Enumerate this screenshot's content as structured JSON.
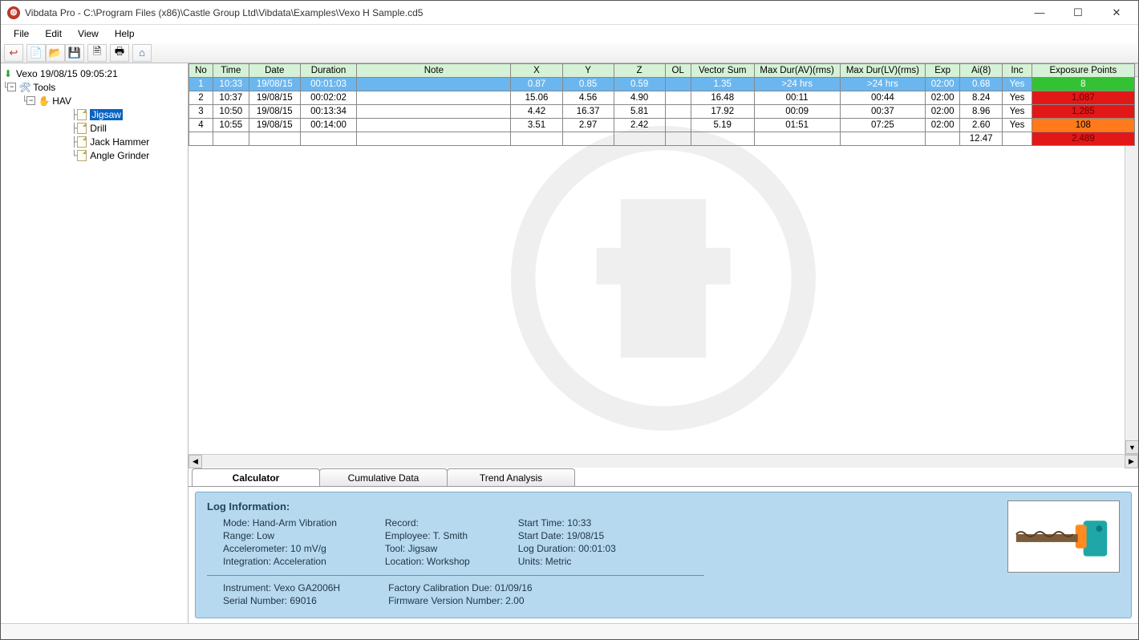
{
  "window": {
    "title": "Vibdata Pro - C:\\Program Files (x86)\\Castle Group Ltd\\Vibdata\\Examples\\Vexo H Sample.cd5"
  },
  "menu": {
    "file": "File",
    "edit": "Edit",
    "view": "View",
    "help": "Help"
  },
  "toolbar_icons": {
    "undo": "↩",
    "new": "📄",
    "open": "📂",
    "save": "💾",
    "doc": "🗎",
    "print": "🖶",
    "home": "⌂"
  },
  "tree": {
    "root": "Vexo 19/08/15 09:05:21",
    "tools": "Tools",
    "hav": "HAV",
    "items": [
      "Jigsaw",
      "Drill",
      "Jack Hammer",
      "Angle Grinder"
    ],
    "selected": "Jigsaw"
  },
  "columns": [
    "No",
    "Time",
    "Date",
    "Duration",
    "Note",
    "X",
    "Y",
    "Z",
    "OL",
    "Vector Sum",
    "Max Dur(AV)(rms)",
    "Max Dur(LV)(rms)",
    "Exp",
    "Ai(8)",
    "Inc",
    "Exposure Points"
  ],
  "rows": [
    {
      "no": "1",
      "time": "10:33",
      "date": "19/08/15",
      "duration": "00:01:03",
      "note": "",
      "x": "0.87",
      "y": "0.85",
      "z": "0.59",
      "ol": "",
      "vsum": "1.35",
      "maxav": ">24 hrs",
      "maxlv": ">24 hrs",
      "exp": "02:00",
      "ai8": "0.68",
      "inc": "Yes",
      "ep": "8",
      "ep_class": "ep-green",
      "selected": true
    },
    {
      "no": "2",
      "time": "10:37",
      "date": "19/08/15",
      "duration": "00:02:02",
      "note": "",
      "x": "15.06",
      "y": "4.56",
      "z": "4.90",
      "ol": "",
      "vsum": "16.48",
      "maxav": "00:11",
      "maxlv": "00:44",
      "exp": "02:00",
      "ai8": "8.24",
      "inc": "Yes",
      "ep": "1,087",
      "ep_class": "ep-red"
    },
    {
      "no": "3",
      "time": "10:50",
      "date": "19/08/15",
      "duration": "00:13:34",
      "note": "",
      "x": "4.42",
      "y": "16.37",
      "z": "5.81",
      "ol": "",
      "vsum": "17.92",
      "maxav": "00:09",
      "maxlv": "00:37",
      "exp": "02:00",
      "ai8": "8.96",
      "inc": "Yes",
      "ep": "1,285",
      "ep_class": "ep-red"
    },
    {
      "no": "4",
      "time": "10:55",
      "date": "19/08/15",
      "duration": "00:14:00",
      "note": "",
      "x": "3.51",
      "y": "2.97",
      "z": "2.42",
      "ol": "",
      "vsum": "5.19",
      "maxav": "01:51",
      "maxlv": "07:25",
      "exp": "02:00",
      "ai8": "2.60",
      "inc": "Yes",
      "ep": "108",
      "ep_class": "ep-orange"
    }
  ],
  "summary": {
    "ai8": "12.47",
    "ep": "2,489",
    "ep_class": "ep-red"
  },
  "tabs": {
    "calculator": "Calculator",
    "cumulative": "Cumulative Data",
    "trend": "Trend Analysis"
  },
  "log": {
    "header": "Log Information:",
    "col1": {
      "mode_lbl": "Mode:",
      "mode": "Hand-Arm Vibration",
      "range_lbl": "Range:",
      "range": "Low",
      "accel_lbl": "Accelerometer:",
      "accel": "10  mV/g",
      "integ_lbl": "Integration:",
      "integ": "Acceleration"
    },
    "col2": {
      "record_lbl": "Record:",
      "record": "",
      "emp_lbl": "Employee:",
      "emp": "T. Smith",
      "tool_lbl": "Tool:",
      "tool": "Jigsaw",
      "loc_lbl": "Location:",
      "loc": "Workshop"
    },
    "col3": {
      "stime_lbl": "Start Time:",
      "stime": "10:33",
      "sdate_lbl": "Start Date:",
      "sdate": "19/08/15",
      "dur_lbl": "Log Duration:",
      "dur": "00:01:03",
      "units_lbl": "Units:",
      "units": "Metric"
    },
    "bottom": {
      "instr_lbl": "Instrument:",
      "instr": "Vexo GA2006H",
      "serial_lbl": "Serial Number:",
      "serial": "69016",
      "cal_lbl": "Factory Calibration Due:",
      "cal": "01/09/16",
      "fw_lbl": "Firmware Version Number:",
      "fw": "2.00"
    }
  }
}
